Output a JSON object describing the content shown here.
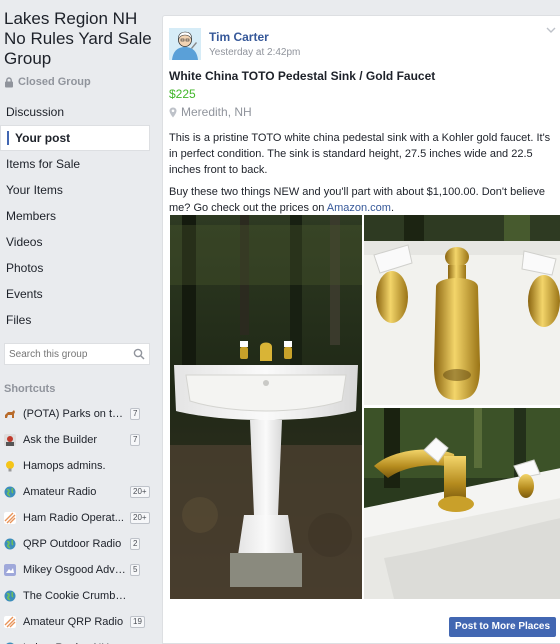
{
  "group": {
    "title": "Lakes Region NH No Rules Yard Sale Group",
    "privacy": "Closed Group"
  },
  "nav": [
    {
      "label": "Discussion",
      "active": false
    },
    {
      "label": "Your post",
      "active": true
    },
    {
      "label": "Items for Sale",
      "active": false
    },
    {
      "label": "Your Items",
      "active": false
    },
    {
      "label": "Members",
      "active": false
    },
    {
      "label": "Videos",
      "active": false
    },
    {
      "label": "Photos",
      "active": false
    },
    {
      "label": "Events",
      "active": false
    },
    {
      "label": "Files",
      "active": false
    }
  ],
  "search": {
    "placeholder": "Search this group"
  },
  "shortcuts": {
    "heading": "Shortcuts",
    "items": [
      {
        "label": "(POTA) Parks on the ...",
        "badge": "7",
        "icon": "dog-icon",
        "color": "#b86b2b"
      },
      {
        "label": "Ask the Builder",
        "badge": "7",
        "icon": "builder-icon",
        "color": "#c0392b"
      },
      {
        "label": "Hamops admins.",
        "badge": "",
        "icon": "lightbulb-icon",
        "color": "#f5c518"
      },
      {
        "label": "Amateur Radio",
        "badge": "20+",
        "icon": "globe-icon",
        "color": "#3c8dbc"
      },
      {
        "label": "Ham Radio Operat...",
        "badge": "20+",
        "icon": "lines-icon",
        "color": "#e8945a"
      },
      {
        "label": "QRP Outdoor Radio",
        "badge": "2",
        "icon": "globe-icon",
        "color": "#3c8dbc"
      },
      {
        "label": "Mikey Osgood Adve...",
        "badge": "5",
        "icon": "photo-icon",
        "color": "#9fa8da"
      },
      {
        "label": "The Cookie Crumble Q...",
        "badge": "",
        "icon": "globe-icon",
        "color": "#3c8dbc"
      },
      {
        "label": "Amateur QRP Radio",
        "badge": "19",
        "icon": "lines-icon",
        "color": "#e8945a"
      },
      {
        "label": "Lakes Region NH No R...",
        "badge": "",
        "icon": "globe-icon",
        "color": "#3c8dbc"
      }
    ]
  },
  "post": {
    "author": "Tim Carter",
    "time": "Yesterday at 2:42pm",
    "title": "White China TOTO Pedestal Sink / Gold Faucet",
    "price": "$225",
    "location": "Meredith, NH",
    "body_p1": "This is a pristine TOTO white china pedestal sink with a Kohler gold faucet. It's in perfect condition. The sink is standard height, 27.5 inches wide and 22.5 inches front to back.",
    "body_p2_before": "Buy these two things NEW and you'll part with about $1,100.00. Don't believe me? Go check out the prices on ",
    "body_p2_link": "Amazon.com",
    "body_p2_after": ".",
    "button_label": "Post to More Places"
  },
  "colors": {
    "link": "#365899",
    "price": "#42b72a",
    "primary_button": "#4267b2"
  }
}
